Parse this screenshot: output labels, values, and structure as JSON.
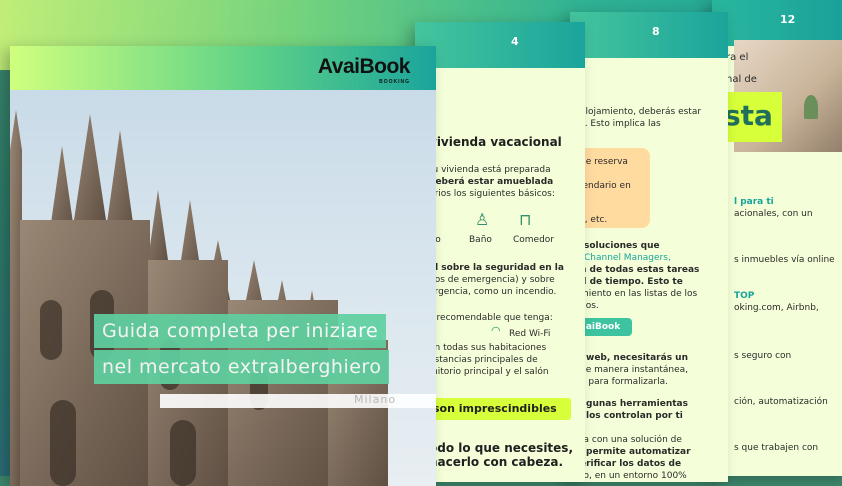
{
  "cover": {
    "logo": "AvaiBook",
    "logo_sub": "BOOKING",
    "title_line1": "Guida completa per iniziare",
    "title_line2": "nel mercato extralberghiero",
    "city": "Milano"
  },
  "page4": {
    "number": "4",
    "heading": "vivienda vacacional",
    "lines": [
      "tu vivienda está preparada",
      "deberá estar amueblada",
      "arios los siguientes básicos:"
    ],
    "icons": [
      "rio",
      "Baño",
      "Comedor"
    ],
    "lines2": [
      "al sobre la seguridad en la",
      "nos de emergencia) y sobre",
      "ergencia, como un incendio.",
      "s recomendable que tenga:"
    ],
    "wifi_label": "Red Wi-Fi",
    "lines3": [
      "en todas sus habitaciones",
      "estancias principales de",
      "mitorio principal y el salón"
    ],
    "highlight": "son imprescindibles",
    "lines4": [
      "odo lo que necesites,",
      "hacerlo con cabeza."
    ]
  },
  "page8": {
    "number": "8",
    "lines": [
      "alojamiento, deberás estar",
      "s. Esto implica las"
    ],
    "box": [
      "de reserva",
      "lendario en",
      "s, etc."
    ],
    "lines2": [
      "soluciones que",
      "Channel Managers,",
      "n de todas estas tareas",
      "d de tiempo. Esto te",
      "miento en las listas de los",
      "dos."
    ],
    "button": "aiBook",
    "lines3": [
      "web, necesitarás un",
      "de manera instantánea,",
      "o para formalizarla.",
      "gunas herramientas",
      "los controlan por ti",
      "ta con una solución de",
      "permite automatizar",
      "erificar los datos de",
      "ro, en un entorno 100%"
    ]
  },
  "page12": {
    "number": "12",
    "top_lines": [
      "ra el",
      "nal de"
    ],
    "yellow_text": "sta",
    "lines": [
      "l para ti",
      "acionales, con un",
      "s inmuebles vía online",
      "TOP",
      "oking.com, Airbnb,",
      "s seguro con",
      "ción, automatización",
      "s que trabajen con"
    ]
  },
  "colors": {
    "accent": "#1aa49b",
    "lime": "#d7ff3a",
    "paper": "#f4ffd9"
  }
}
